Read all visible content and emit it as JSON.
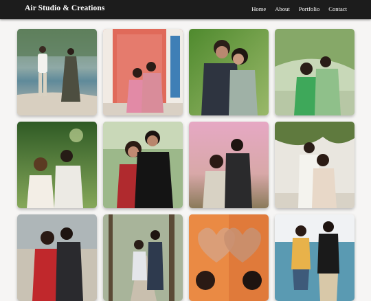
{
  "brand": {
    "name": "Air Studio & Creations"
  },
  "nav": {
    "items": [
      "Home",
      "About",
      "Portfolio",
      "Contact"
    ]
  },
  "colors": {
    "header_bg": "#1c1c1c",
    "page_bg": "#f6f5f4",
    "header_text": "#ffffff"
  },
  "gallery": {
    "photos": [
      {
        "scene": "beach couple walking",
        "name": "gallery-photo-1"
      },
      {
        "scene": "pink door couple",
        "name": "gallery-photo-2"
      },
      {
        "scene": "couple nose touch garden",
        "name": "gallery-photo-3"
      },
      {
        "scene": "palm garden hug",
        "name": "gallery-photo-4"
      },
      {
        "scene": "forest couple smiling",
        "name": "gallery-photo-5"
      },
      {
        "scene": "couple embrace black outfits",
        "name": "gallery-photo-6"
      },
      {
        "scene": "pink sky saree couple",
        "name": "gallery-photo-7"
      },
      {
        "scene": "white wall ivy couple",
        "name": "gallery-photo-8"
      },
      {
        "scene": "red dress seaside",
        "name": "gallery-photo-9"
      },
      {
        "scene": "tree lane dancing",
        "name": "gallery-photo-10"
      },
      {
        "scene": "heart hands",
        "name": "gallery-photo-11"
      },
      {
        "scene": "seaside casual couple",
        "name": "gallery-photo-12"
      }
    ]
  }
}
